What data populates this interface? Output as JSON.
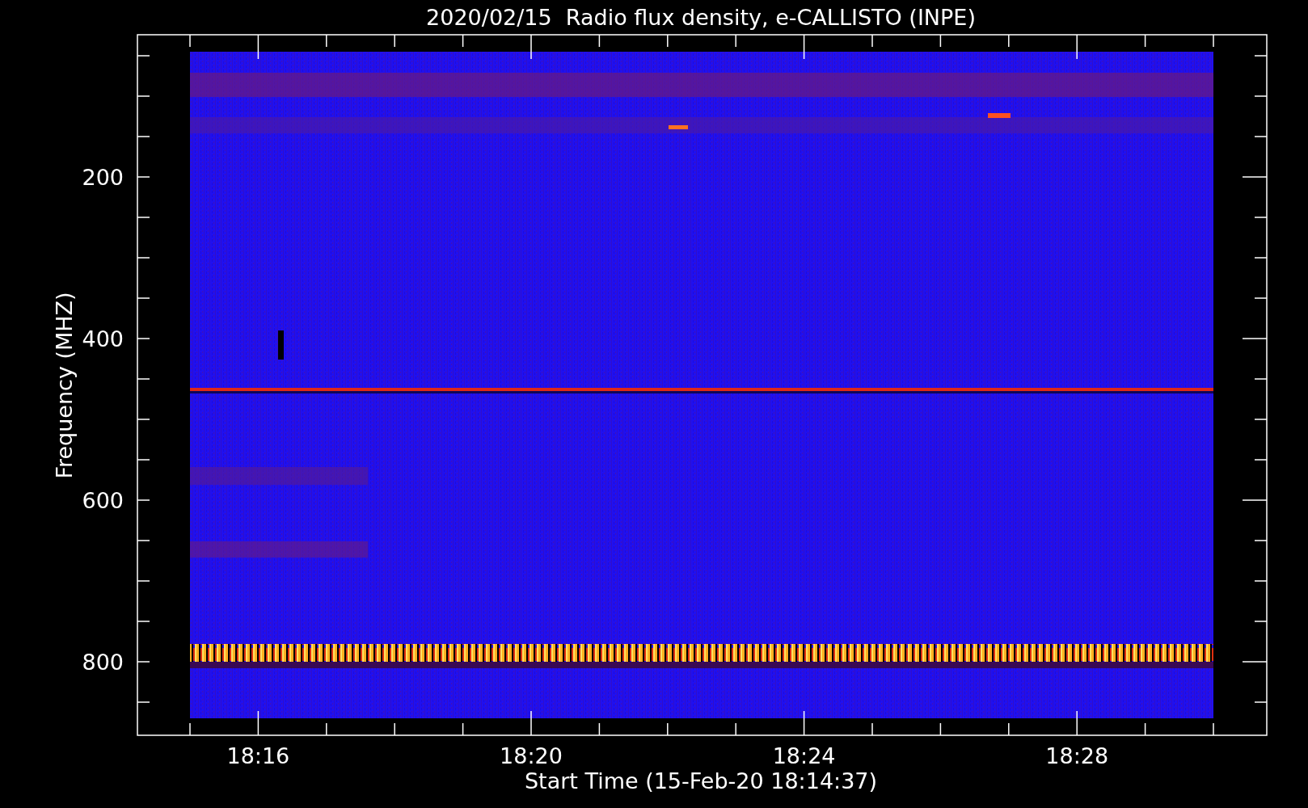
{
  "title": "2020/02/15  Radio flux density, e-CALLISTO (INPE)",
  "y_axis": {
    "label": "Frequency (MHZ)",
    "tick_labels": [
      "200",
      "400",
      "600",
      "800"
    ]
  },
  "x_axis": {
    "label": "Start Time (15-Feb-20 18:14:37)",
    "tick_labels": [
      "18:16",
      "18:20",
      "18:24",
      "18:28"
    ]
  }
}
